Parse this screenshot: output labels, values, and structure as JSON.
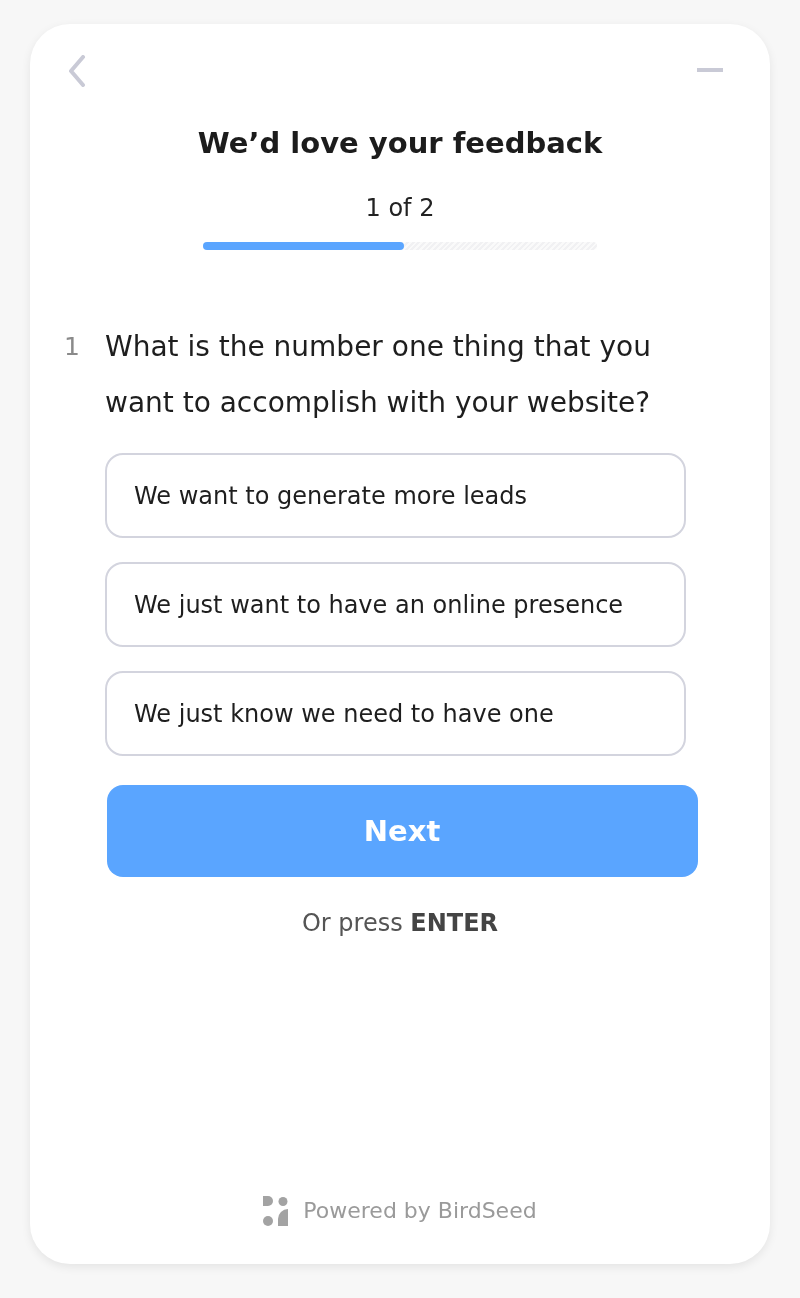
{
  "header": {
    "title": "We’d love your feedback",
    "step": "1 of 2",
    "progress": {
      "level": 0.51
    }
  },
  "question": {
    "number": "1",
    "text": "What is the number one thing that you want to accomplish with your website?",
    "options": [
      {
        "label": "We want to generate more leads",
        "selected": false
      },
      {
        "label": "We just want to have an online presence",
        "selected": false
      },
      {
        "label": "We just know we need to have one",
        "selected": false
      }
    ]
  },
  "next_button": {
    "label": "Next"
  },
  "hint": "Or press **ENTER**",
  "footer": {
    "text": "Powered by BirdSeed"
  }
}
